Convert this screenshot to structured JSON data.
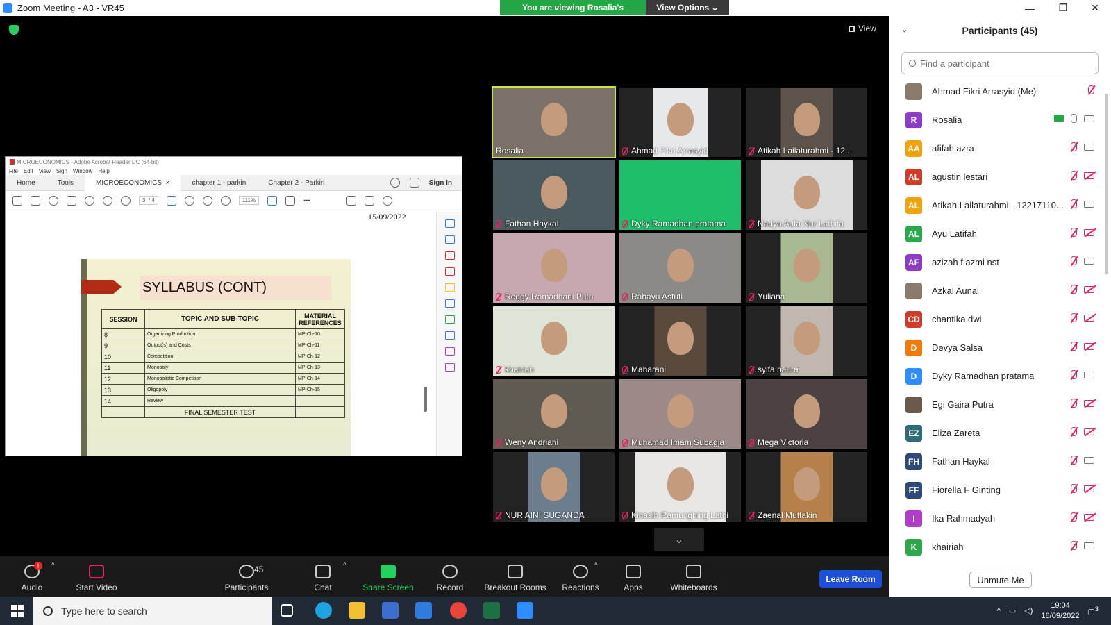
{
  "window": {
    "title": "Zoom Meeting - A3 - VR45",
    "minimize": "—",
    "maximize": "❐",
    "close": "✕"
  },
  "banner": {
    "viewing": "You are viewing Rosalia's screen",
    "view_options": "View Options ⌄"
  },
  "view_button": "View",
  "acrobat": {
    "title": "MICROECONOMICS - Adobe Acrobat Reader DC (64-bit)",
    "menu": [
      "File",
      "Edit",
      "View",
      "Sign",
      "Window",
      "Help"
    ],
    "tabs": {
      "home": "Home",
      "tools": "Tools",
      "doc1": "MICROECONOMICS",
      "doc2": "chapter 1 - parkin",
      "doc3": "Chapter 2 - Parkin",
      "sign_in": "Sign In"
    },
    "page_current": "3",
    "page_total": "/ 4",
    "zoom": "111%",
    "date": "15/09/2022",
    "slide_title": "SYLLABUS (CONT)",
    "table_headers": [
      "SESSION",
      "TOPIC AND SUB-TOPIC",
      "MATERIAL REFERENCES"
    ],
    "rows": [
      [
        "8",
        "Organizing Production",
        "MP-Ch-10"
      ],
      [
        "9",
        "Output(s) and Costs",
        "MP-Ch-11"
      ],
      [
        "10",
        "Competition",
        "MP-Ch-12"
      ],
      [
        "11",
        "Monopoly",
        "MP-Ch-13"
      ],
      [
        "12",
        "Monopolistic Competition",
        "MP-Ch-14"
      ],
      [
        "13",
        "Oligopoly",
        "MP-Ch-15"
      ],
      [
        "14",
        "Review",
        ""
      ]
    ],
    "final_row": "FINAL SEMESTER TEST"
  },
  "videos": [
    "Rosalia",
    "Ahmad Fikri Arrasyid",
    "Atikah Lailaturahmi - 12...",
    "Fathan Haykal",
    "Dyky Ramadhan pratama",
    "Nadya Aufa Nur Lathifa",
    "Reggy Ramadhani Putri",
    "Rahayu Astuti",
    "Yuliana",
    "khairiah",
    "Maharani",
    "syifa naura",
    "Weny Andriani",
    "Muhamad Imam Subagja",
    "Mega Victoria",
    "NUR AINI SUGANDA",
    "Kinasih Ramunghing Lathi",
    "Zaenal Muttakin"
  ],
  "more_arrow": "⌄",
  "panel": {
    "collapse": "⌄",
    "title": "Participants (45)",
    "search_placeholder": "Find a participant",
    "unmute": "Unmute Me",
    "participants": [
      {
        "name": "Ahmad Fikri Arrasyid (Me)",
        "initials": "",
        "color": "#8a7a6a"
      },
      {
        "name": "Rosalia",
        "initials": "R",
        "color": "#8e3bc9"
      },
      {
        "name": "afifah azra",
        "initials": "AA",
        "color": "#f0a30a"
      },
      {
        "name": "agustin lestari",
        "initials": "AL",
        "color": "#d13b2c"
      },
      {
        "name": "Atikah Lailaturahmi - 12217110...",
        "initials": "AL",
        "color": "#f0a30a"
      },
      {
        "name": "Ayu Latifah",
        "initials": "AL",
        "color": "#2aa84a"
      },
      {
        "name": "azizah f azmi nst",
        "initials": "AF",
        "color": "#8e3bc9"
      },
      {
        "name": "Azkal Aunal",
        "initials": "",
        "color": "#8a7a6a"
      },
      {
        "name": "chantika dwi",
        "initials": "CD",
        "color": "#d13b2c"
      },
      {
        "name": "Devya Salsa",
        "initials": "D",
        "color": "#f07a0a"
      },
      {
        "name": "Dyky Ramadhan pratama",
        "initials": "D",
        "color": "#2d8cff"
      },
      {
        "name": "Egi Gaira Putra",
        "initials": "",
        "color": "#6a5a4a"
      },
      {
        "name": "Eliza Zareta",
        "initials": "EZ",
        "color": "#2f6b78"
      },
      {
        "name": "Fathan Haykal",
        "initials": "FH",
        "color": "#2f4a78"
      },
      {
        "name": "Fiorella F Ginting",
        "initials": "FF",
        "color": "#2f4a78"
      },
      {
        "name": "Ika Rahmadyah",
        "initials": "I",
        "color": "#b23bc9"
      },
      {
        "name": "khairiah",
        "initials": "K",
        "color": "#2aa84a"
      }
    ]
  },
  "toolbar": {
    "audio": "Audio",
    "audio_badge": "!",
    "start_video": "Start Video",
    "participants": "Participants",
    "participants_count": "45",
    "chat": "Chat",
    "share": "Share Screen",
    "record": "Record",
    "breakout": "Breakout Rooms",
    "reactions": "Reactions",
    "apps": "Apps",
    "whiteboards": "Whiteboards",
    "leave": "Leave Room",
    "caret": "^"
  },
  "taskbar": {
    "search_placeholder": "Type here to search",
    "time": "19:04",
    "date": "16/09/2022",
    "notif_count": "3"
  }
}
